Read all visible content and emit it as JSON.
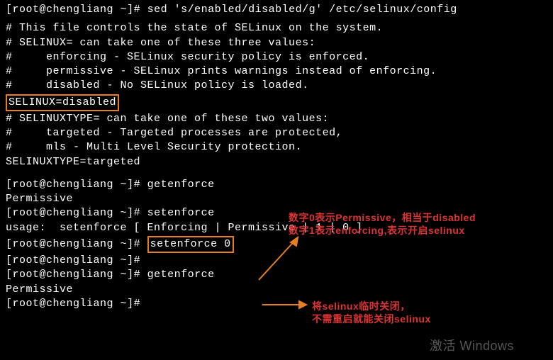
{
  "prompt": {
    "user": "root",
    "host": "chengliang",
    "dir": "~",
    "symbol": "#"
  },
  "cmd1": "sed 's/enabled/disabled/g' /etc/selinux/config",
  "output": {
    "l1": "# This file controls the state of SELinux on the system.",
    "l2": "# SELINUX= can take one of these three values:",
    "l3": "#     enforcing - SELinux security policy is enforced.",
    "l4": "#     permissive - SELinux prints warnings instead of enforcing.",
    "l5": "#     disabled - No SELinux policy is loaded.",
    "l6": "SELINUX=disabled",
    "l7": "# SELINUXTYPE= can take one of these two values:",
    "l8": "#     targeted - Targeted processes are protected,",
    "l9": "#     mls - Multi Level Security protection.",
    "l10": "SELINUXTYPE=targeted"
  },
  "cmd2": "getenforce",
  "out2": "Permissive",
  "cmd3": "setenforce",
  "out3": "usage:  setenforce [ Enforcing | Permissive | 1 | 0 ]",
  "cmd4": "setenforce 0",
  "cmd5": "",
  "cmd6": "getenforce",
  "out6": "Permissive",
  "cmd7": "",
  "annotation1_line1": "数字0表示Permissive，相当于disabled",
  "annotation1_line2": "数字1表示enforcing,表示开启selinux",
  "annotation2_line1": "将selinux临时关闭，",
  "annotation2_line2": "不需重启就能关闭selinux",
  "watermark": "激活 Windows"
}
